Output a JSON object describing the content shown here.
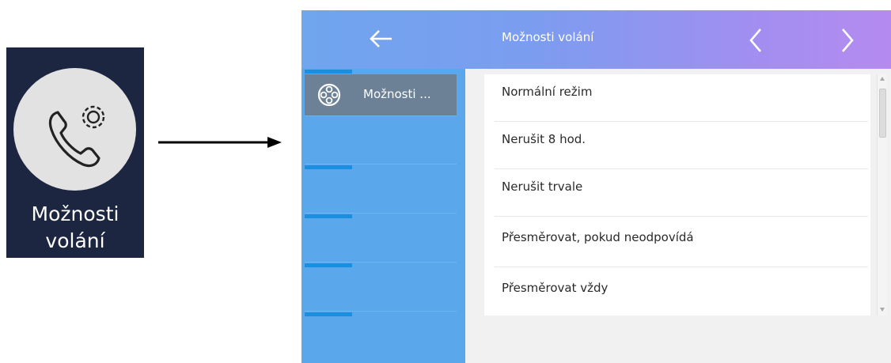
{
  "tile": {
    "label_line1": "Možnosti",
    "label_line2": "volání",
    "icon": "phone-gear-icon"
  },
  "arrow": {
    "icon": "right-arrow-icon"
  },
  "screen": {
    "title": "Možnosti volání",
    "back_icon": "back-arrow-icon",
    "prev_icon": "chevron-left-icon",
    "next_icon": "chevron-right-icon",
    "sidebar": {
      "items": [
        {
          "label": "Možnosti ...",
          "icon": "film-reel-icon",
          "active": true
        },
        {
          "label": ""
        },
        {
          "label": ""
        },
        {
          "label": ""
        },
        {
          "label": ""
        }
      ]
    },
    "options": [
      "Normální režim",
      "Nerušit 8 hod.",
      "Nerušit trvale",
      "Přesměrovat, pokud neodpovídá",
      "Přesměrovat vždy"
    ]
  },
  "colors": {
    "tile_bg": "#1d2640",
    "sidebar_bg": "#5aa7eb",
    "active_item_bg": "#6c8196",
    "accent": "#1a8fe0",
    "header_start": "#6fa6ee",
    "header_end": "#b58af0"
  }
}
